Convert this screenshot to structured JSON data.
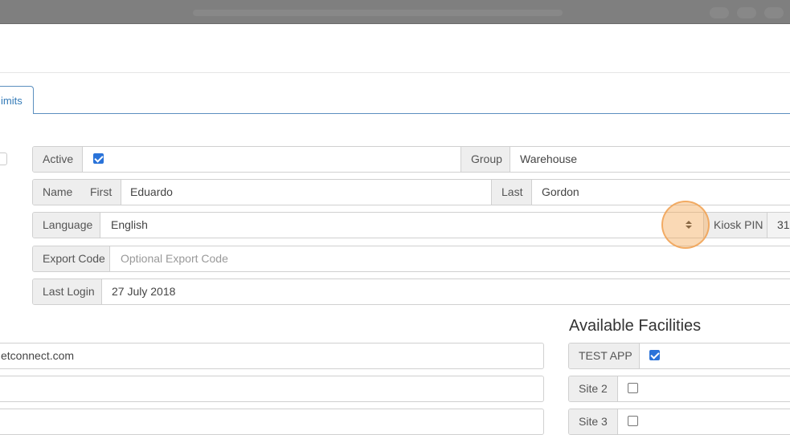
{
  "tab": {
    "label": "imits"
  },
  "user_form": {
    "active_label": "Active",
    "active_checked": true,
    "group_label": "Group",
    "group_value": "Warehouse",
    "name_label": "Name",
    "first_label": "First",
    "first_value": "Eduardo",
    "last_label": "Last",
    "last_value": "Gordon",
    "language_label": "Language",
    "language_value": "English",
    "kiosk_pin_label": "Kiosk PIN",
    "kiosk_pin_value": "31",
    "export_code_label": "Export Code",
    "export_code_placeholder": "Optional Export Code",
    "last_login_label": "Last Login",
    "last_login_value": "27 July 2018"
  },
  "contact": {
    "email_value": "etconnect.com",
    "field2_value": "",
    "field3_value": ""
  },
  "facilities": {
    "title": "Available Facilities",
    "items": [
      {
        "label": "TEST APP",
        "checked": true
      },
      {
        "label": "Site 2",
        "checked": false
      },
      {
        "label": "Site 3",
        "checked": false
      }
    ]
  },
  "icons": {
    "select_arrows": "sort-arrows-icon",
    "checkbox": "checkbox-icon"
  },
  "colors": {
    "tab_border": "#5b8fbf",
    "checkbox_checked": "#2a73d9",
    "addon_bg": "#eeeeee",
    "cursor_highlight": "#f5aa5a"
  }
}
